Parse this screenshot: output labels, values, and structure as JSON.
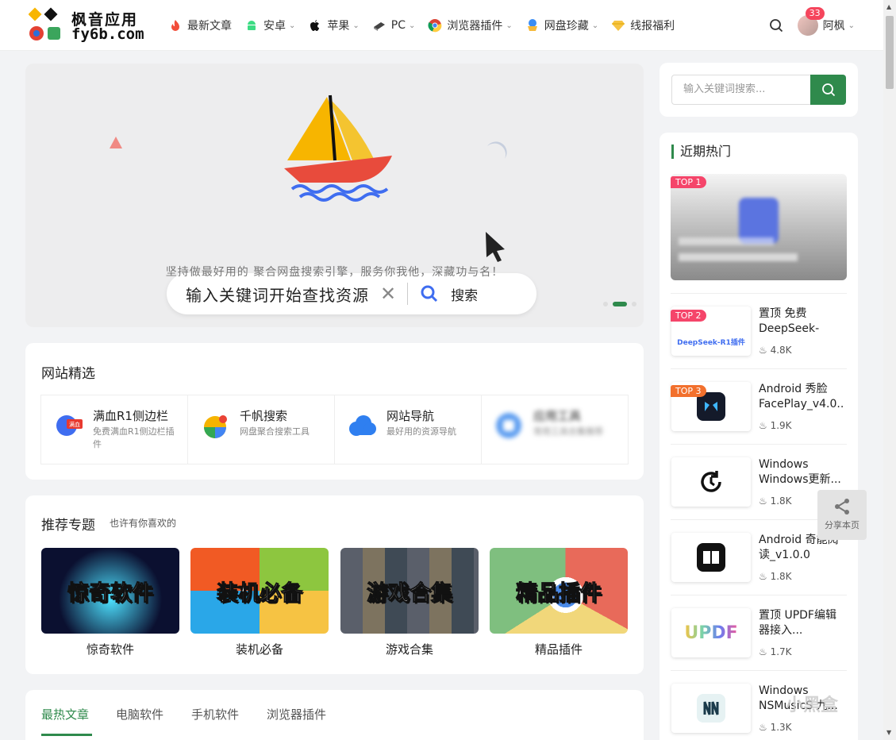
{
  "header": {
    "logo_line1": "枫音应用",
    "logo_line2": "fy6b.com",
    "nav": [
      {
        "label": "最新文章",
        "icon": "fire-icon",
        "dropdown": false
      },
      {
        "label": "安卓",
        "icon": "android-icon",
        "dropdown": true
      },
      {
        "label": "苹果",
        "icon": "apple-icon",
        "dropdown": true
      },
      {
        "label": "PC",
        "icon": "laptop-icon",
        "dropdown": true
      },
      {
        "label": "浏览器插件",
        "icon": "chrome-icon",
        "dropdown": true
      },
      {
        "label": "网盘珍藏",
        "icon": "cloud-icon",
        "dropdown": true
      },
      {
        "label": "线报福利",
        "icon": "diamond-icon",
        "dropdown": false
      }
    ],
    "notification_count": "33",
    "username": "阿枫"
  },
  "banner": {
    "search_text": "输入关键词开始查找资源",
    "search_button": "搜索",
    "subtitle": "坚持做最好用的 聚合网盘搜索引擎，服务你我他，深藏功与名！"
  },
  "picks": {
    "title": "网站精选",
    "items": [
      {
        "title": "满血R1侧边栏",
        "desc": "免费满血R1侧边栏插件",
        "icon_label": "满血"
      },
      {
        "title": "千帆搜索",
        "desc": "网盘聚合搜索工具"
      },
      {
        "title": "网站导航",
        "desc": "最好用的资源导航"
      },
      {
        "title": "应用工具",
        "desc": "常用工具合集推荐"
      }
    ]
  },
  "topics": {
    "title": "推荐专题",
    "subtitle": "也许有你喜欢的",
    "items": [
      {
        "image_text": "惊奇软件",
        "caption": "惊奇软件"
      },
      {
        "image_text": "装机必备",
        "caption": "装机必备"
      },
      {
        "image_text": "游戏合集",
        "caption": "游戏合集"
      },
      {
        "image_text": "精品插件",
        "caption": "精品插件"
      }
    ]
  },
  "tabs": [
    {
      "label": "最热文章",
      "active": true
    },
    {
      "label": "电脑软件",
      "active": false
    },
    {
      "label": "手机软件",
      "active": false
    },
    {
      "label": "浏览器插件",
      "active": false
    }
  ],
  "sidebar": {
    "search_placeholder": "输入关键词搜索...",
    "hot_title": "近期热门",
    "top1_tag": "TOP 1",
    "items": [
      {
        "tag": "TOP 2",
        "title": "置顶 免费DeepSeek-R1...",
        "views": "4.8K",
        "thumb_text": "DeepSeek-R1插件"
      },
      {
        "tag": "TOP 3",
        "title": "Android 秀脸FacePlay_v4.0....",
        "views": "1.9K"
      },
      {
        "tag": "",
        "title": "Windows Windows更新...",
        "views": "1.8K"
      },
      {
        "tag": "",
        "title": "Android 奇能阅读_v1.0.0",
        "views": "1.8K"
      },
      {
        "tag": "",
        "title": "置顶 UPDF编辑器接入...",
        "views": "1.7K",
        "thumb_text": "UPDF"
      },
      {
        "tag": "",
        "title": "Windows NSMusicS 九...",
        "views": "1.3K"
      }
    ]
  },
  "share": {
    "label": "分享本页"
  },
  "watermark": "小黑盒",
  "colors": {
    "accent": "#2f8a4c",
    "hot_tag": "#f5456a",
    "top_tag": "#f2702d",
    "badge": "#f5455c"
  }
}
